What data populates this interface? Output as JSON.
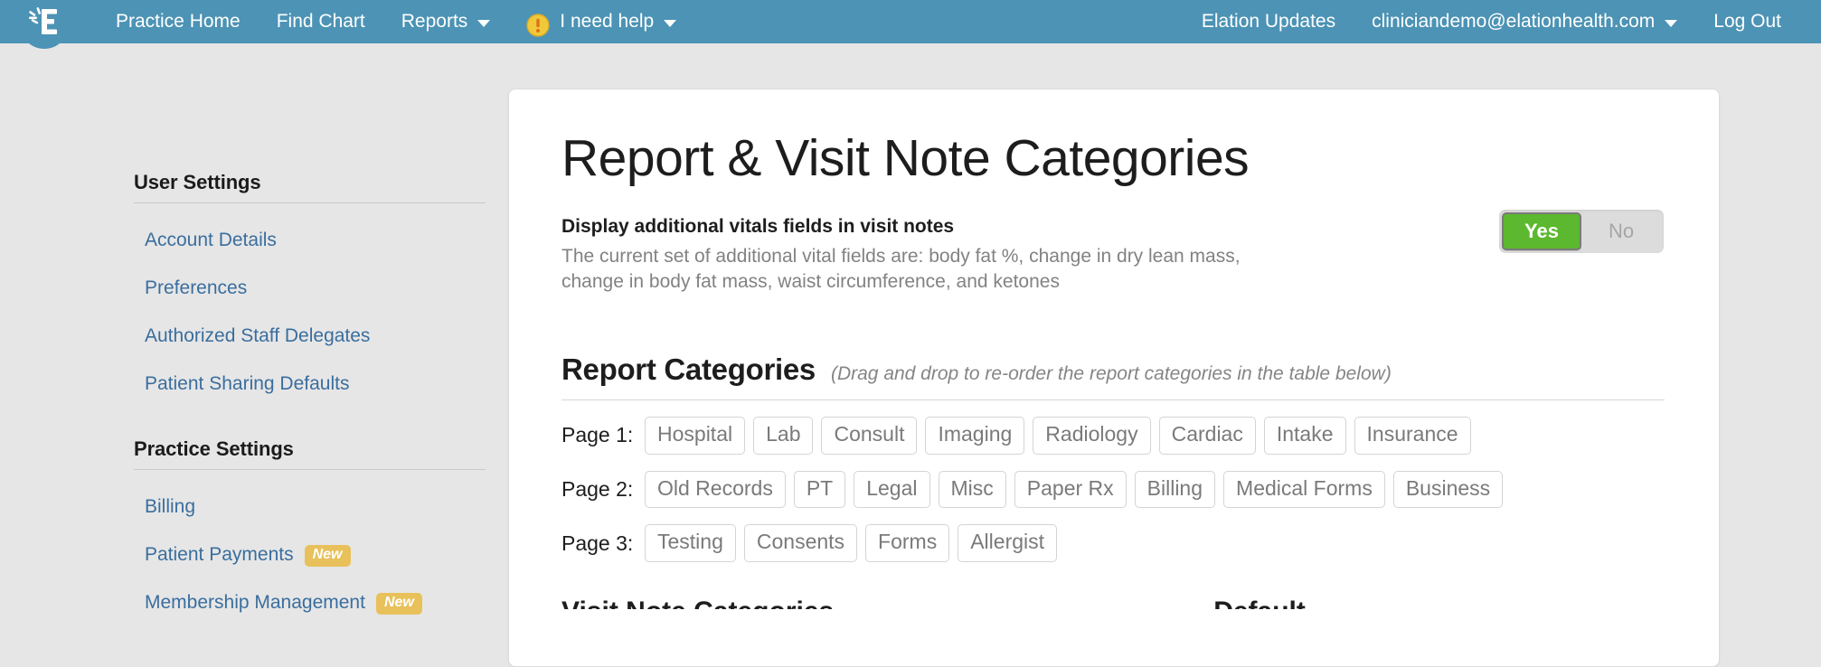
{
  "brand": {
    "logo_icon": "elation-e-logo-icon",
    "nav_background": "#4c93b5"
  },
  "topnav": {
    "left_items": [
      {
        "label": "Practice Home",
        "icon": null,
        "caret": false
      },
      {
        "label": "Find Chart",
        "icon": null,
        "caret": false
      },
      {
        "label": "Reports",
        "icon": null,
        "caret": true
      },
      {
        "label": "I need help",
        "icon": "warning-circle-icon",
        "caret": true
      }
    ],
    "right_items": [
      {
        "label": "Elation Updates",
        "caret": false
      },
      {
        "label": "cliniciandemo@elationhealth.com",
        "caret": true
      },
      {
        "label": "Log Out",
        "caret": false
      }
    ]
  },
  "sidebar": {
    "groups": [
      {
        "title": "User Settings",
        "items": [
          {
            "label": "Account Details",
            "badge": null
          },
          {
            "label": "Preferences",
            "badge": null
          },
          {
            "label": "Authorized Staff Delegates",
            "badge": null
          },
          {
            "label": "Patient Sharing Defaults",
            "badge": null
          }
        ]
      },
      {
        "title": "Practice Settings",
        "items": [
          {
            "label": "Billing",
            "badge": null
          },
          {
            "label": "Patient Payments",
            "badge": "New"
          },
          {
            "label": "Membership Management",
            "badge": "New"
          }
        ]
      }
    ]
  },
  "main": {
    "title": "Report & Visit Note Categories",
    "vitals": {
      "label": "Display additional vitals fields in visit notes",
      "description": "The current set of additional vital fields are: body fat %, change in dry lean mass, change in body fat mass, waist circumference, and ketones",
      "toggle": {
        "yes_label": "Yes",
        "no_label": "No",
        "selected": "Yes",
        "on_color": "#5cb82e",
        "off_color": "#dcdcdc"
      }
    },
    "report_categories": {
      "heading": "Report Categories",
      "hint": "(Drag and drop to re-order the report categories in the table below)",
      "pages": [
        {
          "label": "Page 1:",
          "chips": [
            "Hospital",
            "Lab",
            "Consult",
            "Imaging",
            "Radiology",
            "Cardiac",
            "Intake",
            "Insurance"
          ]
        },
        {
          "label": "Page 2:",
          "chips": [
            "Old Records",
            "PT",
            "Legal",
            "Misc",
            "Paper Rx",
            "Billing",
            "Medical Forms",
            "Business"
          ]
        },
        {
          "label": "Page 3:",
          "chips": [
            "Testing",
            "Consents",
            "Forms",
            "Allergist"
          ]
        }
      ]
    },
    "cut_off": {
      "left": "Visit Note Categories",
      "right": "Default"
    }
  }
}
